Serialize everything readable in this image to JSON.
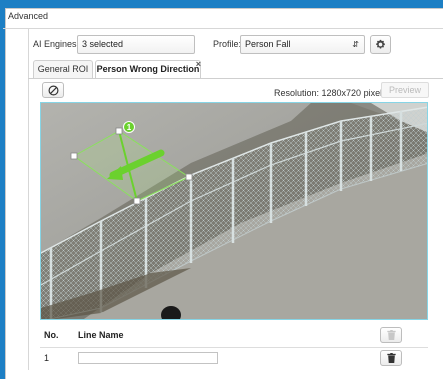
{
  "section": {
    "title": "Advanced"
  },
  "ai_engines": {
    "label": "AI Engines:",
    "value": "3 selected"
  },
  "profile": {
    "label": "Profile:",
    "value": "Person Fall"
  },
  "icons": {
    "settings": "gear-icon",
    "clear": "cancel-icon",
    "delete": "trash-icon",
    "close": "close-icon"
  },
  "tabs": [
    {
      "label": "General ROI",
      "active": false
    },
    {
      "label": "Person Wrong Direction",
      "active": true,
      "close": "×"
    }
  ],
  "video": {
    "resolution": "Resolution:  1280x720 pixel",
    "preview_label": "Preview",
    "line_badge": "1",
    "line_color": "#6bd12e"
  },
  "table": {
    "columns": [
      "No.",
      "Line Name"
    ],
    "rows": [
      {
        "no": "1",
        "name": ""
      }
    ]
  }
}
